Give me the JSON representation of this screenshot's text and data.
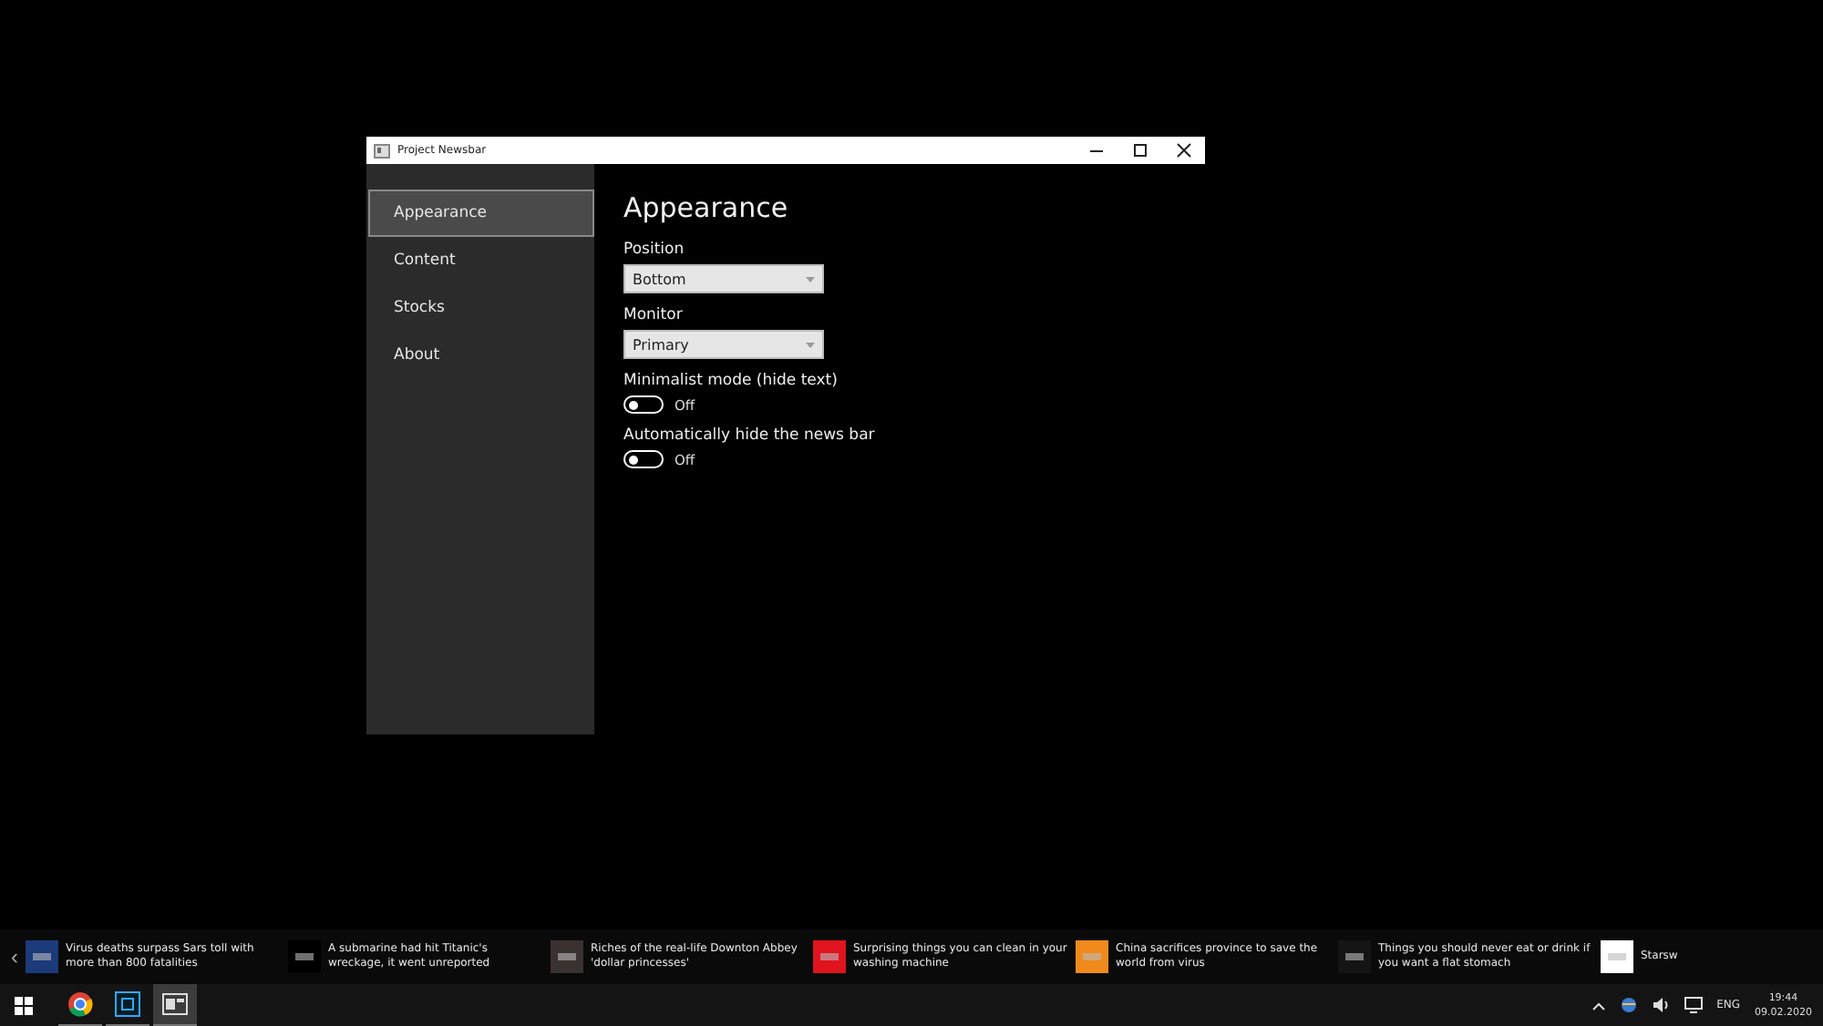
{
  "window": {
    "title": "Project Newsbar"
  },
  "sidebar": {
    "items": [
      {
        "label": "Appearance",
        "selected": true
      },
      {
        "label": "Content",
        "selected": false
      },
      {
        "label": "Stocks",
        "selected": false
      },
      {
        "label": "About",
        "selected": false
      }
    ]
  },
  "page": {
    "heading": "Appearance",
    "settings": [
      {
        "kind": "dropdown",
        "label": "Position",
        "value": "Bottom"
      },
      {
        "kind": "dropdown",
        "label": "Monitor",
        "value": "Primary"
      },
      {
        "kind": "toggle",
        "label": "Minimalist mode  (hide text)",
        "on": false,
        "state": "Off"
      },
      {
        "kind": "toggle",
        "label": "Automatically hide the news bar",
        "on": false,
        "state": "Off"
      }
    ]
  },
  "news_bar": {
    "prev": "‹",
    "items": [
      {
        "headline": "Virus deaths surpass Sars toll with more than 800 fatalities",
        "color": "#1a3a7a"
      },
      {
        "headline": "A submarine had hit Titanic's wreckage, it went unreported",
        "color": "#000000"
      },
      {
        "headline": "Riches of the real-life Downton Abbey 'dollar princesses'",
        "color": "#3a3230"
      },
      {
        "headline": "Surprising things you can clean in your washing machine",
        "color": "#e0131e"
      },
      {
        "headline": "China sacrifices province to save the world from virus",
        "color": "#f08a1c"
      },
      {
        "headline": "Things you should never eat or drink if you want a flat stomach",
        "color": "#141414"
      },
      {
        "headline": "Starsw",
        "color": "#ffffff"
      }
    ]
  },
  "taskbar": {
    "apps": [
      {
        "kind": "browser",
        "selected": false
      },
      {
        "kind": "photoshop",
        "selected": false
      },
      {
        "kind": "newsbar",
        "selected": true
      }
    ],
    "language": "ENG",
    "time": "19:44",
    "date": "09.02.2020"
  }
}
